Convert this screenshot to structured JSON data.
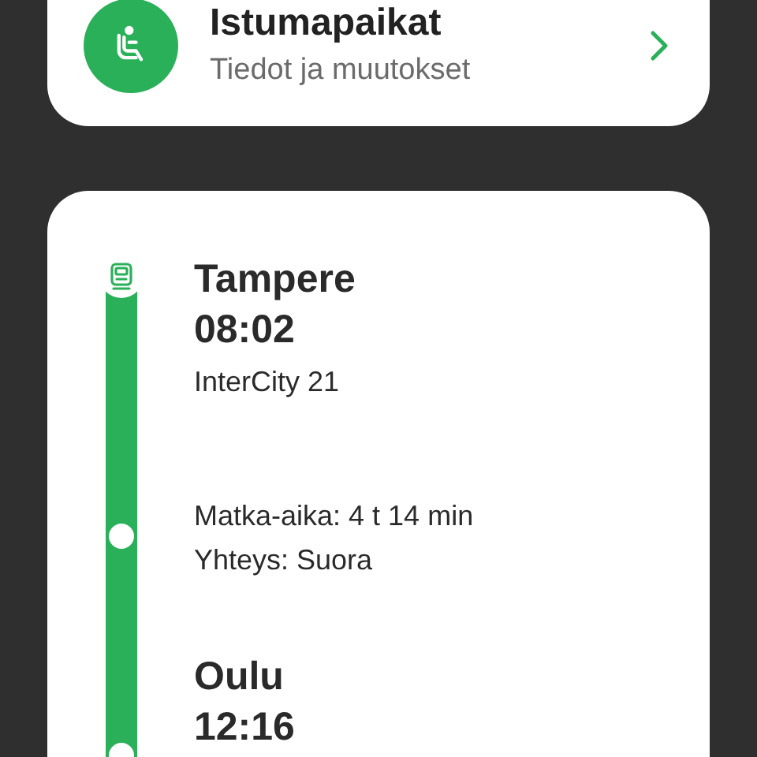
{
  "seat_card": {
    "title": "Istumapaikat",
    "subtitle": "Tiedot ja muutokset"
  },
  "journey": {
    "departure": {
      "station": "Tampere",
      "time": "08:02",
      "train": "InterCity 21"
    },
    "details": [
      "Matka-aika: 4 t 14 min",
      "Yhteys: Suora"
    ],
    "arrival": {
      "station": "Oulu",
      "time": "12:16"
    }
  }
}
